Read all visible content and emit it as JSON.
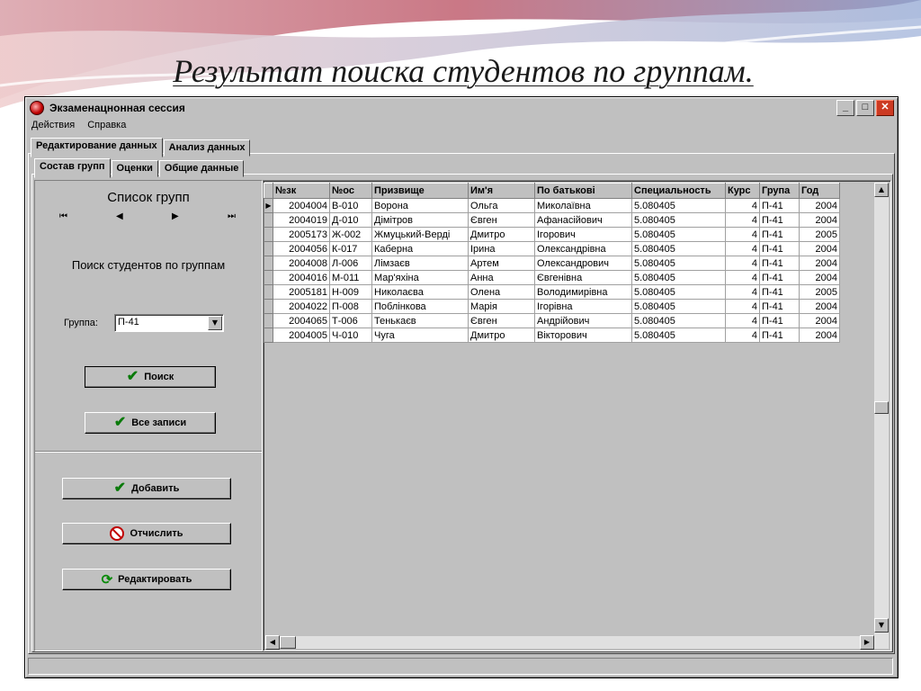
{
  "slide": {
    "title": "Результат поиска студентов по группам."
  },
  "window": {
    "title": "Экзаменацнонная сессия",
    "controls": {
      "minimize": "_",
      "maximize": "□",
      "close": "✕"
    }
  },
  "menu": [
    "Действия",
    "Справка"
  ],
  "main_tabs": [
    "Редактирование данных",
    "Анализ данных"
  ],
  "sub_tabs": [
    "Состав групп",
    "Оценки",
    "Общие данные"
  ],
  "left_panel": {
    "list_title": "Список групп",
    "nav": {
      "first": "⏮",
      "prev": "◀",
      "next": "▶",
      "last": "⏭"
    },
    "search_caption": "Поиск студентов по группам",
    "group_label": "Группа:",
    "group_value": "П-41",
    "search_button": "Поиск",
    "all_records_button": "Все записи",
    "add_button": "Добавить",
    "expel_button": "Отчислить",
    "edit_button": "Редактировать"
  },
  "table": {
    "columns": [
      "№зк",
      "№ос",
      "Призвище",
      "Им'я",
      "По батькові",
      "Специальность",
      "Курс",
      "Група",
      "Год"
    ],
    "rows": [
      [
        "2004004",
        "В-010",
        "Ворона",
        "Ольга",
        "Миколаївна",
        "5.080405",
        "4",
        "П-41",
        "2004"
      ],
      [
        "2004019",
        "Д-010",
        "Дімітров",
        "Євген",
        "Афанасійович",
        "5.080405",
        "4",
        "П-41",
        "2004"
      ],
      [
        "2005173",
        "Ж-002",
        "Жмуцький-Верді",
        "Дмитро",
        "Ігорович",
        "5.080405",
        "4",
        "П-41",
        "2005"
      ],
      [
        "2004056",
        "К-017",
        "Каберна",
        "Ірина",
        "Олександрівна",
        "5.080405",
        "4",
        "П-41",
        "2004"
      ],
      [
        "2004008",
        "Л-006",
        "Лімзаєв",
        "Артем",
        "Олександрович",
        "5.080405",
        "4",
        "П-41",
        "2004"
      ],
      [
        "2004016",
        "М-011",
        "Мар'яхіна",
        "Анна",
        "Євгенівна",
        "5.080405",
        "4",
        "П-41",
        "2004"
      ],
      [
        "2005181",
        "Н-009",
        "Николаєва",
        "Олена",
        "Володимирівна",
        "5.080405",
        "4",
        "П-41",
        "2005"
      ],
      [
        "2004022",
        "П-008",
        "Поблінкова",
        "Марія",
        "Ігорівна",
        "5.080405",
        "4",
        "П-41",
        "2004"
      ],
      [
        "2004065",
        "Т-006",
        "Тенькаєв",
        "Євген",
        "Андрійович",
        "5.080405",
        "4",
        "П-41",
        "2004"
      ],
      [
        "2004005",
        "Ч-010",
        "Чуга",
        "Дмитро",
        "Вікторович",
        "5.080405",
        "4",
        "П-41",
        "2004"
      ]
    ],
    "current_row_indicator": "▶"
  }
}
